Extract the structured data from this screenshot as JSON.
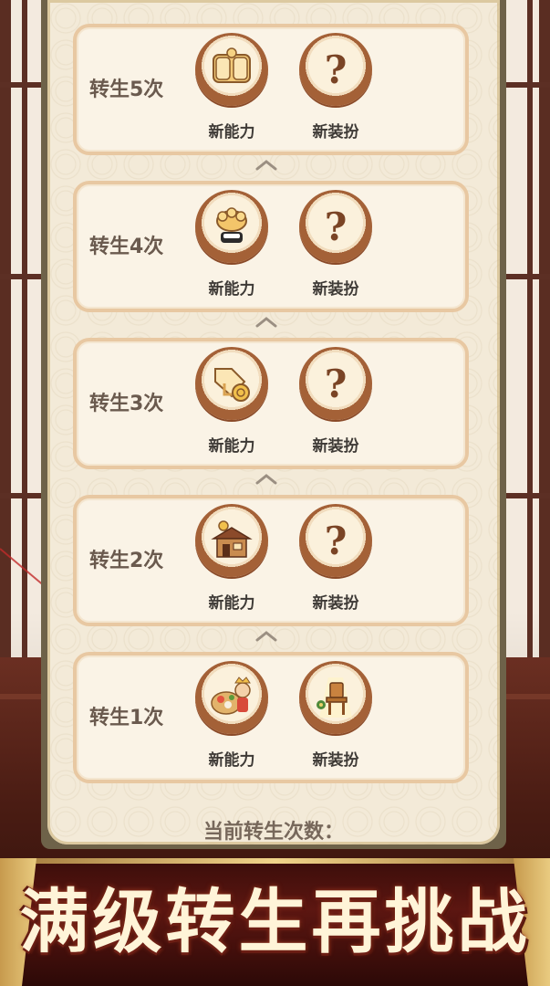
{
  "rebirth_rows": [
    {
      "label": "转生5次",
      "ability_label": "新能力",
      "outfit_label": "新装扮",
      "ability_icon": "coin-scroll-icon",
      "outfit_icon": "question-mark-icon"
    },
    {
      "label": "转生4次",
      "ability_label": "新能力",
      "outfit_label": "新装扮",
      "ability_icon": "sushi-bun-icon",
      "outfit_icon": "question-mark-icon"
    },
    {
      "label": "转生3次",
      "ability_label": "新能力",
      "outfit_label": "新装扮",
      "ability_icon": "tag-coin-icon",
      "outfit_icon": "question-mark-icon"
    },
    {
      "label": "转生2次",
      "ability_label": "新能力",
      "outfit_label": "新装扮",
      "ability_icon": "shop-building-icon",
      "outfit_icon": "question-mark-icon"
    },
    {
      "label": "转生1次",
      "ability_label": "新能力",
      "outfit_label": "新装扮",
      "ability_icon": "food-platter-chef-icon",
      "outfit_icon": "wooden-chair-icon"
    }
  ],
  "unknown_glyph": "?",
  "current_count_label": "当前转生次数：",
  "slogan": "满级转生再挑战",
  "colors": {
    "panel_bg": "#f3ead8",
    "row_border": "#e8c8a2",
    "medal_ring": "#a46137",
    "banner": "#5c1611",
    "slogan_text": "#fff4d8"
  }
}
